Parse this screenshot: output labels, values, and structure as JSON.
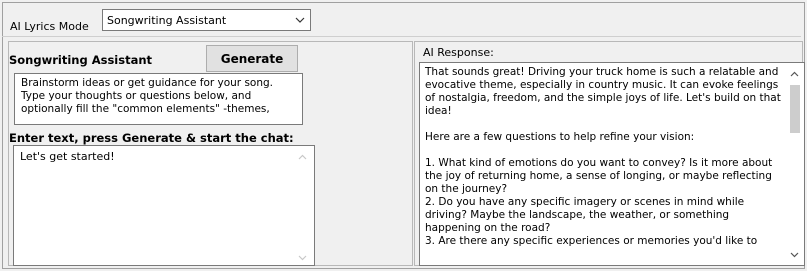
{
  "header": {
    "mode_label": "AI Lyrics Mode",
    "mode_value": "Songwriting Assistant"
  },
  "left": {
    "title": "Songwriting Assistant",
    "generate_label": "Generate",
    "info_lines": [
      "Brainstorm ideas or get guidance for your song.",
      "Type your thoughts or questions below, and",
      "optionally fill the \"common elements\" -themes,"
    ],
    "enter_label": "Enter text, press Generate & start the chat:",
    "chat_value": "Let's get started!"
  },
  "right": {
    "label": "AI Response:",
    "paragraphs": [
      "That sounds great! Driving your truck home is such a relatable and evocative theme, especially in country music. It can evoke feelings of nostalgia, freedom, and the simple joys of life. Let's build on that idea!",
      "Here are a few questions to help refine your vision:"
    ],
    "list": [
      "1. What kind of emotions do you want to convey? Is it more about the joy of returning home, a sense of longing, or maybe reflecting on the journey?",
      "2. Do you have any specific imagery or scenes in mind while driving? Maybe the landscape, the weather, or something happening on the road?",
      "3. Are there any specific experiences or memories you'd like to"
    ]
  },
  "icons": {
    "dropdown": "chevron-down-icon",
    "scroll_up": "scroll-up-arrow-icon",
    "scroll_down": "scroll-down-arrow-icon"
  }
}
